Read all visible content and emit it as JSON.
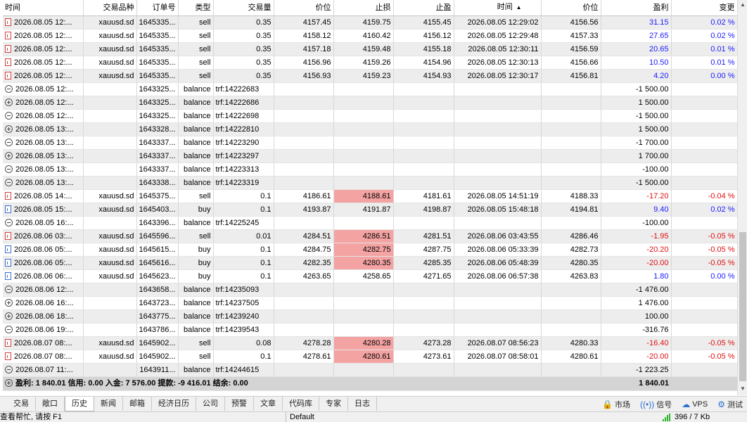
{
  "columns": [
    "时间",
    "交易品种",
    "订单号",
    "类型",
    "交易量",
    "价位",
    "止损",
    "止盈",
    "时间",
    "价位",
    "盈利",
    "变更"
  ],
  "sort_indicator": "▲",
  "rows": [
    {
      "icon": "doc-sell",
      "time": "2026.08.05 12:...",
      "symbol": "xauusd.sd",
      "order": "1645335...",
      "type": "sell",
      "volume": "0.35",
      "price": "4157.45",
      "sl": "4159.75",
      "tp": "4155.45",
      "close_time": "2026.08.05 12:29:02",
      "close_price": "4156.56",
      "profit": "31.15",
      "profit_color": "blue",
      "change": "0.02 %",
      "change_color": "blue",
      "sl_highlight": false
    },
    {
      "icon": "doc-sell",
      "time": "2026.08.05 12:...",
      "symbol": "xauusd.sd",
      "order": "1645335...",
      "type": "sell",
      "volume": "0.35",
      "price": "4158.12",
      "sl": "4160.42",
      "tp": "4156.12",
      "close_time": "2026.08.05 12:29:48",
      "close_price": "4157.33",
      "profit": "27.65",
      "profit_color": "blue",
      "change": "0.02 %",
      "change_color": "blue",
      "sl_highlight": false
    },
    {
      "icon": "doc-sell",
      "time": "2026.08.05 12:...",
      "symbol": "xauusd.sd",
      "order": "1645335...",
      "type": "sell",
      "volume": "0.35",
      "price": "4157.18",
      "sl": "4159.48",
      "tp": "4155.18",
      "close_time": "2026.08.05 12:30:11",
      "close_price": "4156.59",
      "profit": "20.65",
      "profit_color": "blue",
      "change": "0.01 %",
      "change_color": "blue",
      "sl_highlight": false
    },
    {
      "icon": "doc-sell",
      "time": "2026.08.05 12:...",
      "symbol": "xauusd.sd",
      "order": "1645335...",
      "type": "sell",
      "volume": "0.35",
      "price": "4156.96",
      "sl": "4159.26",
      "tp": "4154.96",
      "close_time": "2026.08.05 12:30:13",
      "close_price": "4156.66",
      "profit": "10.50",
      "profit_color": "blue",
      "change": "0.01 %",
      "change_color": "blue",
      "sl_highlight": false
    },
    {
      "icon": "doc-sell",
      "time": "2026.08.05 12:...",
      "symbol": "xauusd.sd",
      "order": "1645335...",
      "type": "sell",
      "volume": "0.35",
      "price": "4156.93",
      "sl": "4159.23",
      "tp": "4154.93",
      "close_time": "2026.08.05 12:30:17",
      "close_price": "4156.81",
      "profit": "4.20",
      "profit_color": "blue",
      "change": "0.00 %",
      "change_color": "blue",
      "sl_highlight": false
    },
    {
      "icon": "minus",
      "time": "2026.08.05 12:...",
      "symbol": "",
      "order": "1643325...",
      "type": "balance",
      "volume": "trf:14222683",
      "price": "",
      "sl": "",
      "tp": "",
      "close_time": "",
      "close_price": "",
      "profit": "-1 500.00",
      "profit_color": "black",
      "change": "",
      "change_color": "black",
      "sl_highlight": false
    },
    {
      "icon": "plus",
      "time": "2026.08.05 12:...",
      "symbol": "",
      "order": "1643325...",
      "type": "balance",
      "volume": "trf:14222686",
      "price": "",
      "sl": "",
      "tp": "",
      "close_time": "",
      "close_price": "",
      "profit": "1 500.00",
      "profit_color": "black",
      "change": "",
      "change_color": "black",
      "sl_highlight": false
    },
    {
      "icon": "minus",
      "time": "2026.08.05 12:...",
      "symbol": "",
      "order": "1643325...",
      "type": "balance",
      "volume": "trf:14222698",
      "price": "",
      "sl": "",
      "tp": "",
      "close_time": "",
      "close_price": "",
      "profit": "-1 500.00",
      "profit_color": "black",
      "change": "",
      "change_color": "black",
      "sl_highlight": false
    },
    {
      "icon": "plus",
      "time": "2026.08.05 13:...",
      "symbol": "",
      "order": "1643328...",
      "type": "balance",
      "volume": "trf:14222810",
      "price": "",
      "sl": "",
      "tp": "",
      "close_time": "",
      "close_price": "",
      "profit": "1 500.00",
      "profit_color": "black",
      "change": "",
      "change_color": "black",
      "sl_highlight": false
    },
    {
      "icon": "minus",
      "time": "2026.08.05 13:...",
      "symbol": "",
      "order": "1643337...",
      "type": "balance",
      "volume": "trf:14223290",
      "price": "",
      "sl": "",
      "tp": "",
      "close_time": "",
      "close_price": "",
      "profit": "-1 700.00",
      "profit_color": "black",
      "change": "",
      "change_color": "black",
      "sl_highlight": false
    },
    {
      "icon": "plus",
      "time": "2026.08.05 13:...",
      "symbol": "",
      "order": "1643337...",
      "type": "balance",
      "volume": "trf:14223297",
      "price": "",
      "sl": "",
      "tp": "",
      "close_time": "",
      "close_price": "",
      "profit": "1 700.00",
      "profit_color": "black",
      "change": "",
      "change_color": "black",
      "sl_highlight": false
    },
    {
      "icon": "minus",
      "time": "2026.08.05 13:...",
      "symbol": "",
      "order": "1643337...",
      "type": "balance",
      "volume": "trf:14223313",
      "price": "",
      "sl": "",
      "tp": "",
      "close_time": "",
      "close_price": "",
      "profit": "-100.00",
      "profit_color": "black",
      "change": "",
      "change_color": "black",
      "sl_highlight": false
    },
    {
      "icon": "minus",
      "time": "2026.08.05 13:...",
      "symbol": "",
      "order": "1643338...",
      "type": "balance",
      "volume": "trf:14223319",
      "price": "",
      "sl": "",
      "tp": "",
      "close_time": "",
      "close_price": "",
      "profit": "-1 500.00",
      "profit_color": "black",
      "change": "",
      "change_color": "black",
      "sl_highlight": false
    },
    {
      "icon": "doc-sell",
      "time": "2026.08.05 14:...",
      "symbol": "xauusd.sd",
      "order": "1645375...",
      "type": "sell",
      "volume": "0.1",
      "price": "4186.61",
      "sl": "4188.61",
      "tp": "4181.61",
      "close_time": "2026.08.05 14:51:19",
      "close_price": "4188.33",
      "profit": "-17.20",
      "profit_color": "red",
      "change": "-0.04 %",
      "change_color": "red",
      "sl_highlight": true
    },
    {
      "icon": "doc-buy",
      "time": "2026.08.05 15:...",
      "symbol": "xauusd.sd",
      "order": "1645403...",
      "type": "buy",
      "volume": "0.1",
      "price": "4193.87",
      "sl": "4191.87",
      "tp": "4198.87",
      "close_time": "2026.08.05 15:48:18",
      "close_price": "4194.81",
      "profit": "9.40",
      "profit_color": "blue",
      "change": "0.02 %",
      "change_color": "blue",
      "sl_highlight": false
    },
    {
      "icon": "minus",
      "time": "2026.08.05 16:...",
      "symbol": "",
      "order": "1643396...",
      "type": "balance",
      "volume": "trf:14225245",
      "price": "",
      "sl": "",
      "tp": "",
      "close_time": "",
      "close_price": "",
      "profit": "-100.00",
      "profit_color": "black",
      "change": "",
      "change_color": "black",
      "sl_highlight": false
    },
    {
      "icon": "doc-sell",
      "time": "2026.08.06 03:...",
      "symbol": "xauusd.sd",
      "order": "1645596...",
      "type": "sell",
      "volume": "0.01",
      "price": "4284.51",
      "sl": "4286.51",
      "tp": "4281.51",
      "close_time": "2026.08.06 03:43:55",
      "close_price": "4286.46",
      "profit": "-1.95",
      "profit_color": "red",
      "change": "-0.05 %",
      "change_color": "red",
      "sl_highlight": true
    },
    {
      "icon": "doc-buy",
      "time": "2026.08.06 05:...",
      "symbol": "xauusd.sd",
      "order": "1645615...",
      "type": "buy",
      "volume": "0.1",
      "price": "4284.75",
      "sl": "4282.75",
      "tp": "4287.75",
      "close_time": "2026.08.06 05:33:39",
      "close_price": "4282.73",
      "profit": "-20.20",
      "profit_color": "red",
      "change": "-0.05 %",
      "change_color": "red",
      "sl_highlight": true
    },
    {
      "icon": "doc-buy",
      "time": "2026.08.06 05:...",
      "symbol": "xauusd.sd",
      "order": "1645616...",
      "type": "buy",
      "volume": "0.1",
      "price": "4282.35",
      "sl": "4280.35",
      "tp": "4285.35",
      "close_time": "2026.08.06 05:48:39",
      "close_price": "4280.35",
      "profit": "-20.00",
      "profit_color": "red",
      "change": "-0.05 %",
      "change_color": "red",
      "sl_highlight": true
    },
    {
      "icon": "doc-buy",
      "time": "2026.08.06 06:...",
      "symbol": "xauusd.sd",
      "order": "1645623...",
      "type": "buy",
      "volume": "0.1",
      "price": "4263.65",
      "sl": "4258.65",
      "tp": "4271.65",
      "close_time": "2026.08.06 06:57:38",
      "close_price": "4263.83",
      "profit": "1.80",
      "profit_color": "blue",
      "change": "0.00 %",
      "change_color": "blue",
      "sl_highlight": false
    },
    {
      "icon": "minus",
      "time": "2026.08.06 12:...",
      "symbol": "",
      "order": "1643658...",
      "type": "balance",
      "volume": "trf:14235093",
      "price": "",
      "sl": "",
      "tp": "",
      "close_time": "",
      "close_price": "",
      "profit": "-1 476.00",
      "profit_color": "black",
      "change": "",
      "change_color": "black",
      "sl_highlight": false
    },
    {
      "icon": "plus",
      "time": "2026.08.06 16:...",
      "symbol": "",
      "order": "1643723...",
      "type": "balance",
      "volume": "trf:14237505",
      "price": "",
      "sl": "",
      "tp": "",
      "close_time": "",
      "close_price": "",
      "profit": "1 476.00",
      "profit_color": "black",
      "change": "",
      "change_color": "black",
      "sl_highlight": false
    },
    {
      "icon": "plus",
      "time": "2026.08.06 18:...",
      "symbol": "",
      "order": "1643775...",
      "type": "balance",
      "volume": "trf:14239240",
      "price": "",
      "sl": "",
      "tp": "",
      "close_time": "",
      "close_price": "",
      "profit": "100.00",
      "profit_color": "black",
      "change": "",
      "change_color": "black",
      "sl_highlight": false
    },
    {
      "icon": "minus",
      "time": "2026.08.06 19:...",
      "symbol": "",
      "order": "1643786...",
      "type": "balance",
      "volume": "trf:14239543",
      "price": "",
      "sl": "",
      "tp": "",
      "close_time": "",
      "close_price": "",
      "profit": "-316.76",
      "profit_color": "black",
      "change": "",
      "change_color": "black",
      "sl_highlight": false
    },
    {
      "icon": "doc-sell",
      "time": "2026.08.07 08:...",
      "symbol": "xauusd.sd",
      "order": "1645902...",
      "type": "sell",
      "volume": "0.08",
      "price": "4278.28",
      "sl": "4280.28",
      "tp": "4273.28",
      "close_time": "2026.08.07 08:56:23",
      "close_price": "4280.33",
      "profit": "-16.40",
      "profit_color": "red",
      "change": "-0.05 %",
      "change_color": "red",
      "sl_highlight": true
    },
    {
      "icon": "doc-sell",
      "time": "2026.08.07 08:...",
      "symbol": "xauusd.sd",
      "order": "1645902...",
      "type": "sell",
      "volume": "0.1",
      "price": "4278.61",
      "sl": "4280.61",
      "tp": "4273.61",
      "close_time": "2026.08.07 08:58:01",
      "close_price": "4280.61",
      "profit": "-20.00",
      "profit_color": "red",
      "change": "-0.05 %",
      "change_color": "red",
      "sl_highlight": true
    },
    {
      "icon": "minus",
      "time": "2026.08.07 11:...",
      "symbol": "",
      "order": "1643911...",
      "type": "balance",
      "volume": "trf:14244615",
      "price": "",
      "sl": "",
      "tp": "",
      "close_time": "",
      "close_price": "",
      "profit": "-1 223.25",
      "profit_color": "black",
      "change": "",
      "change_color": "black",
      "sl_highlight": false
    }
  ],
  "summary": {
    "text": "盈利: 1 840.01  信用: 0.00  入金: 7 576.00  提款: -9 416.01  结余: 0.00",
    "profit": "1 840.01"
  },
  "tabs": [
    {
      "label": "交易",
      "active": false
    },
    {
      "label": "敞口",
      "active": false
    },
    {
      "label": "历史",
      "active": true
    },
    {
      "label": "新闻",
      "active": false
    },
    {
      "label": "邮箱",
      "active": false
    },
    {
      "label": "经济日历",
      "active": false
    },
    {
      "label": "公司",
      "active": false
    },
    {
      "label": "预警",
      "active": false
    },
    {
      "label": "文章",
      "active": false
    },
    {
      "label": "代码库",
      "active": false
    },
    {
      "label": "专家",
      "active": false
    },
    {
      "label": "日志",
      "active": false
    }
  ],
  "right_tools": [
    {
      "label": "市场",
      "icon": "bag-icon"
    },
    {
      "label": "信号",
      "icon": "signal-icon"
    },
    {
      "label": "VPS",
      "icon": "cloud-icon"
    },
    {
      "label": "测试",
      "icon": "tester-icon"
    }
  ],
  "status": {
    "help": "查看帮忙, 请按 F1",
    "profile": "Default",
    "traffic": "396 / 7 Kb"
  },
  "colors": {
    "blue": "#1a1aff",
    "red": "#e01010",
    "sl_highlight": "#f4a3a3",
    "row_alt": "#ededed"
  }
}
